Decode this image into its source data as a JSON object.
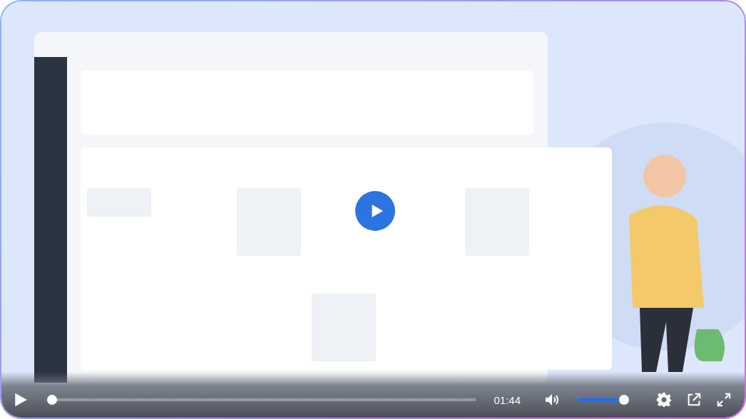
{
  "controls": {
    "playing": false,
    "progress": {
      "level": 0.0
    },
    "time": "01:44",
    "muted": false,
    "volume": {
      "level": 1.0
    }
  }
}
